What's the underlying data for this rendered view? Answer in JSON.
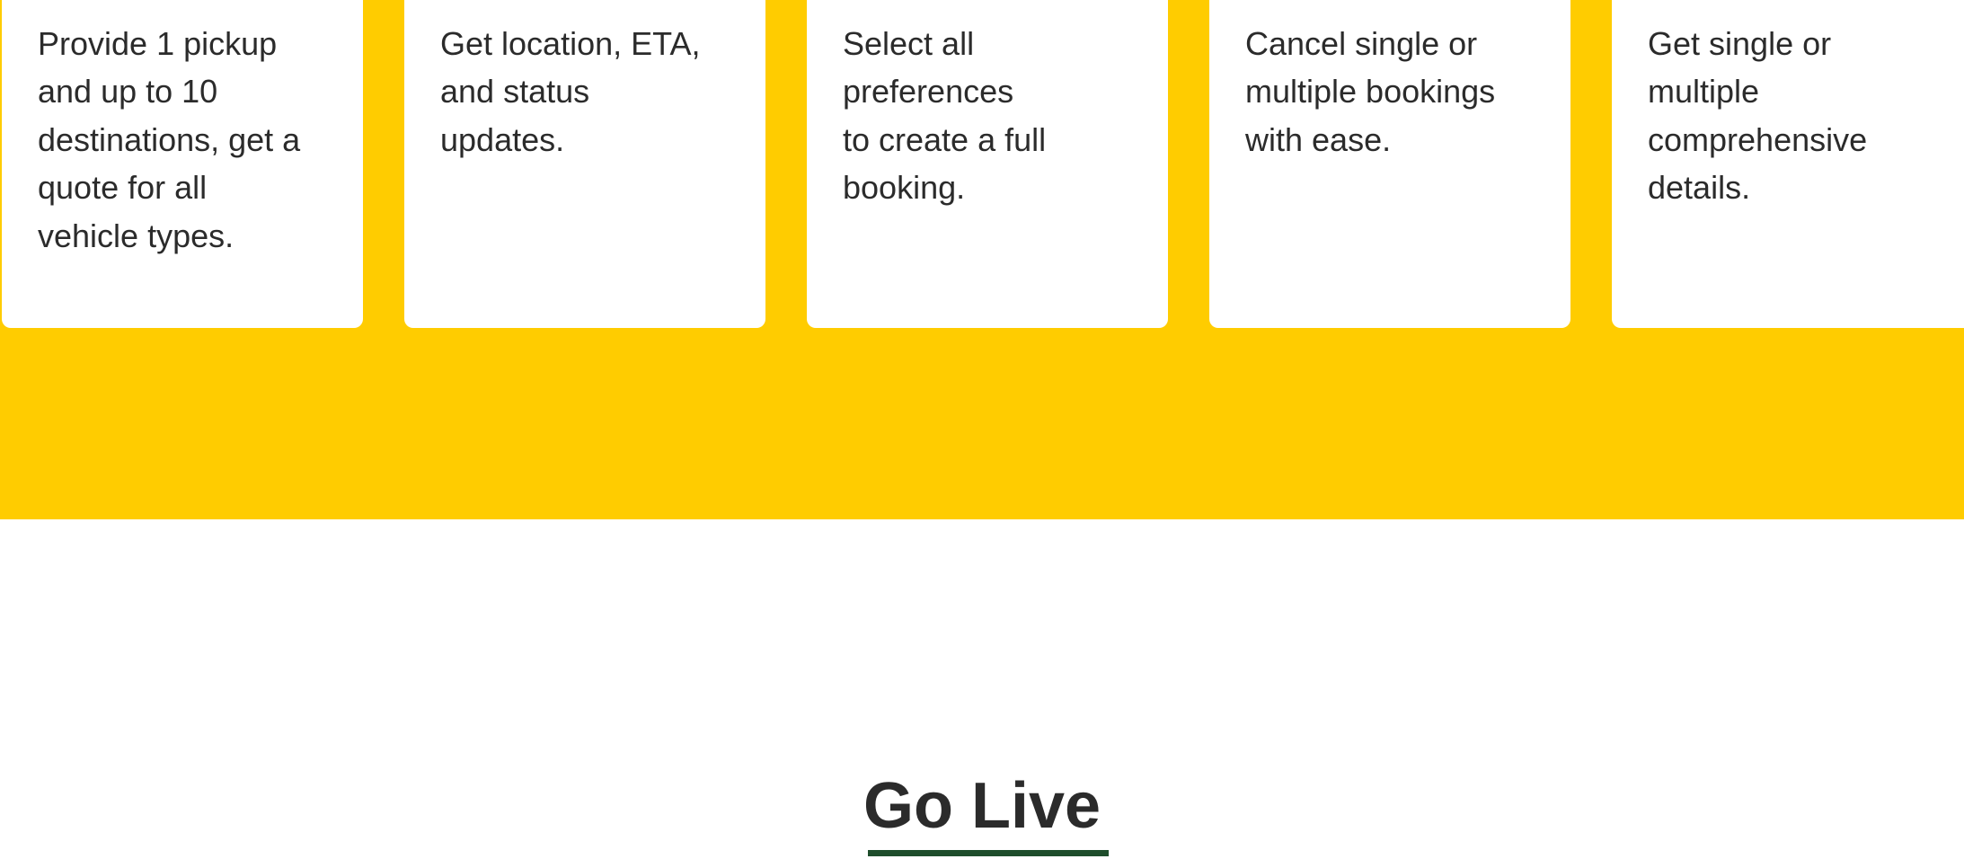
{
  "colors": {
    "band_background": "#FFCC00",
    "card_background": "#ffffff",
    "text": "#2b2b2b",
    "underline": "#1e4d2b"
  },
  "features": {
    "cards": [
      {
        "title": "",
        "description": "Provide 1 pickup\nand up to 10\ndestinations, get a\nquote for all\nvehicle types."
      },
      {
        "title": "",
        "description": "Get location, ETA,\nand status\nupdates."
      },
      {
        "title": "",
        "description": "Select all\npreferences\nto create a full\nbooking."
      },
      {
        "title": "",
        "description": "Cancel single or\nmultiple bookings\nwith ease."
      },
      {
        "title": "",
        "description": "Get single or\nmultiple\ncomprehensive\ndetails."
      }
    ]
  },
  "go_live": {
    "title": "Go Live"
  }
}
